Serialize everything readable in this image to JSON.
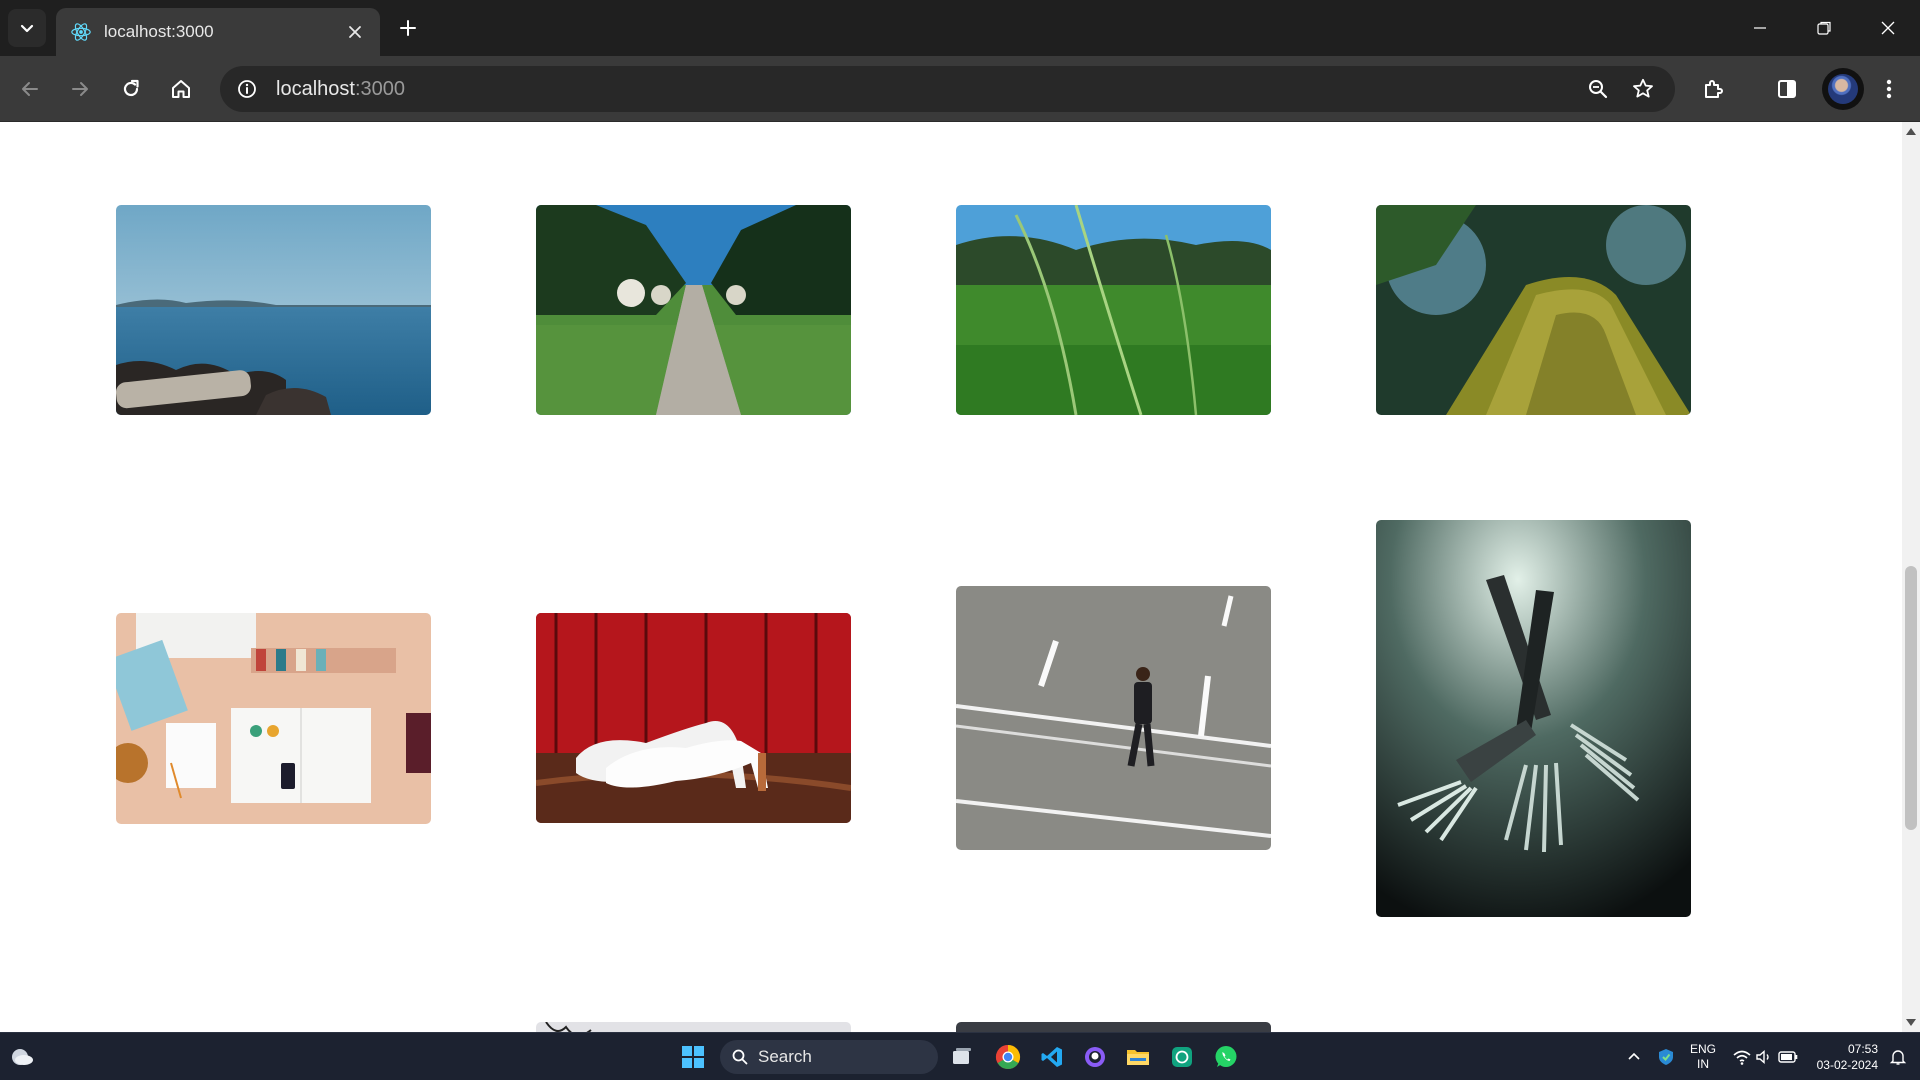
{
  "tab": {
    "title": "localhost:3000"
  },
  "address_bar": {
    "host": "localhost",
    "port": ":3000"
  },
  "gallery": {
    "photos": [
      {
        "name": "lake-shore-photo"
      },
      {
        "name": "forest-path-photo"
      },
      {
        "name": "grass-field-photo"
      },
      {
        "name": "mossy-tree-photo"
      },
      {
        "name": "desk-flatlay-photo"
      },
      {
        "name": "white-heels-photo"
      },
      {
        "name": "man-walking-road-photo"
      },
      {
        "name": "forks-photo"
      },
      {
        "name": "partial-photo-bottom-left"
      },
      {
        "name": "partial-photo-bottom-right"
      }
    ]
  },
  "taskbar": {
    "search_label": "Search",
    "language_line1": "ENG",
    "language_line2": "IN",
    "time": "07:53",
    "date": "03-02-2024"
  },
  "colors": {
    "tabstrip_bg": "#1f1f1f",
    "toolbar_bg": "#3a3a3a",
    "omnibox_bg": "#282828",
    "taskbar_bg": "#1c2230",
    "page_bg": "#ffffff"
  }
}
